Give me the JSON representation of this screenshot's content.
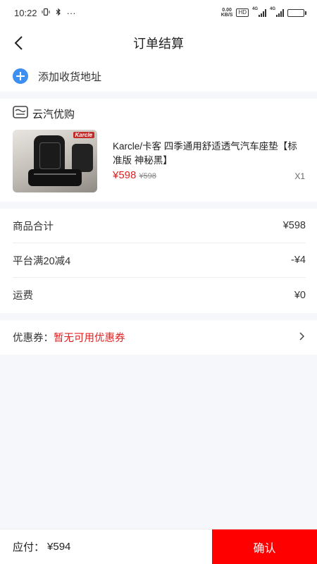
{
  "status_bar": {
    "time": "10:22",
    "more": "···",
    "net_speed_value": "0.00",
    "net_speed_unit": "KB/S",
    "hd": "HD",
    "signal_label": "4G"
  },
  "nav": {
    "title": "订单结算"
  },
  "address": {
    "add_label": "添加收货地址"
  },
  "shop": {
    "name": "云汽优购",
    "product": {
      "title": "Karcle/卡客 四季通用舒适透气汽车座垫【标准版 神秘黑】",
      "brand_tag": "Karcle",
      "price": "¥598",
      "original_price": "¥598",
      "quantity": "X1"
    }
  },
  "summary": {
    "goods_total_label": "商品合计",
    "goods_total_value": "¥598",
    "discount_label": "平台满20减4",
    "discount_value": "-¥4",
    "shipping_label": "运费",
    "shipping_value": "¥0"
  },
  "coupon": {
    "label": "优惠券：",
    "value": "暂无可用优惠券"
  },
  "footer": {
    "pay_label": "应付：",
    "pay_amount": "¥594",
    "confirm_label": "确认"
  },
  "colors": {
    "accent_red": "#ff0000",
    "price_red": "#e02020",
    "plus_blue": "#3d8ff0"
  },
  "icons": [
    "back-arrow-icon",
    "plus-icon",
    "shop-icon",
    "chevron-right-icon",
    "vibrate-icon",
    "bluetooth-icon",
    "signal-icon",
    "battery-icon"
  ]
}
